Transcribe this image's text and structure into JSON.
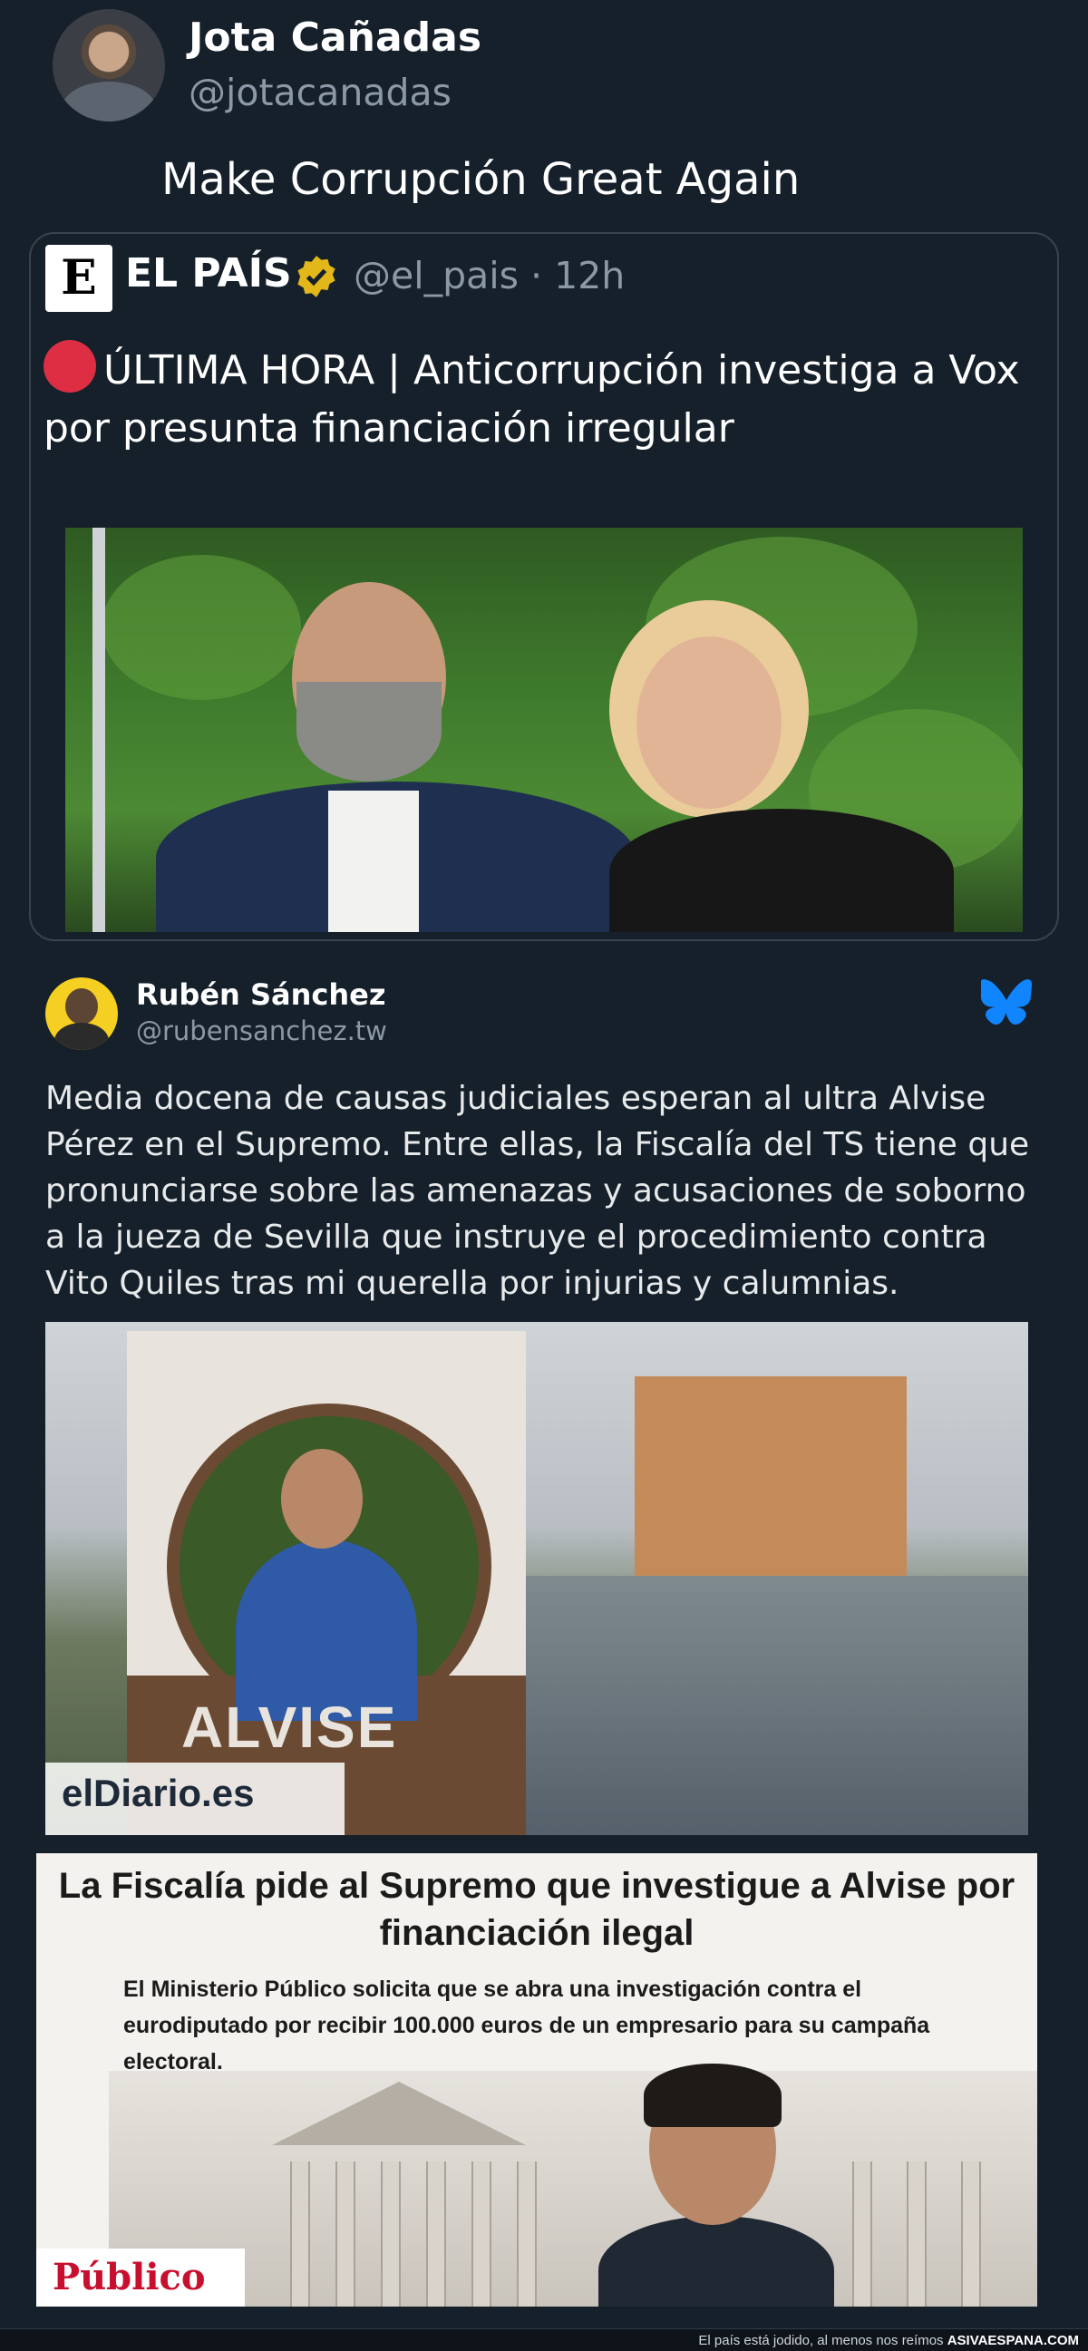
{
  "tweet": {
    "author_name": "Jota Cañadas",
    "author_handle": "@jotacanadas",
    "text": "Make Corrupción Great Again"
  },
  "quoted": {
    "logo_letter": "E",
    "name": "EL PAÍS",
    "handle_time": "@el_pais · 12h",
    "text": "ÚLTIMA HORA | Anticorrupción investiga a Vox por presunta financiación irregular"
  },
  "embedded_post": {
    "author_name": "Rubén Sánchez",
    "author_handle": "@rubensanchez.tw",
    "text": "Media docena de causas judiciales esperan al ultra Alvise Pérez en el Supremo. Entre ellas, la Fiscalía del TS tiene que pronunciarse sobre las amenazas y acusaciones de soborno a la jueza de Sevilla que instruye el procedimiento contra Vito Quiles tras mi querella por injurias y calumnias.",
    "photo_poster_name": "ALVISE",
    "photo_source": "elDiario.es"
  },
  "article_card": {
    "headline": "La Fiscalía pide al Supremo que investigue a Alvise por financiación ilegal",
    "subhead": "El Ministerio Público solicita que se abra una investigación contra el eurodiputado por recibir 100.000 euros de un empresario para su campaña electoral.",
    "source": "Público"
  },
  "footer": {
    "text": "El país está jodido, al menos nos reímos",
    "site": "ASIVAESPANA.COM"
  },
  "colors": {
    "background": "#15202b",
    "secondary_text": "#8b98a5",
    "verified_gold": "#e2b719",
    "bluesky_blue": "#1185fe",
    "alert_red": "#dd2e44"
  }
}
